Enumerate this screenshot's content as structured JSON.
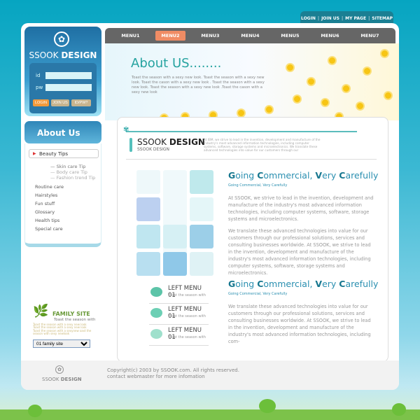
{
  "top_links": [
    "LOGIN",
    "JOIN US",
    "MY PAGE",
    "SITEMAP"
  ],
  "logo": {
    "brand_light": "SSOOK ",
    "brand_bold": "DESIGN"
  },
  "login": {
    "id_label": "id",
    "pw_label": "pw",
    "id_value": "",
    "pw_value": "",
    "buttons": [
      "LOGIN",
      "JOIN US",
      "ID/PW?"
    ]
  },
  "sidebar": {
    "title": "About Us",
    "active": "Beauty Tips",
    "sub_items": [
      "Skin care Tip",
      "Body care Tip",
      "Fashion trend Tip"
    ],
    "items": [
      "Routine care",
      "Hairstyles",
      "Fun stuff",
      "Glossary",
      "Health tips",
      "Special care"
    ]
  },
  "family": {
    "title": "FAMILY SITE",
    "subtitle": "Toast the season with",
    "desc": "Toast the season with a sexy new look Toast the season with a sexy new look Toast the season with a sexynew  oast the season with sexy newlook",
    "select": "01 family site"
  },
  "nav": {
    "items": [
      "MENU1",
      "MENU2",
      "MENU3",
      "MENU4",
      "MENU5",
      "MENU6",
      "MENU7"
    ],
    "active": 1
  },
  "hero": {
    "title": "About US........",
    "desc": "Toast the season with a sexy new look. Toast the season with a sexy new look. Toast the cason with a sexy new look . Toast the season with a sexy new look. Toast the season with a sexy new look .Toast the cason with a sexy new look"
  },
  "card": {
    "brand_light": "SSOOK ",
    "brand_bold": "DESIGN",
    "brand_sub": "SSOOK DESIGN",
    "intro": "At IBM, we strive to lead in the invention, development and manufacture of the industry's most advanced information technologies, including computer systems, software, storage systems and microelectronics. We translate these advanced technologies into value for our customers through our"
  },
  "sections": [
    {
      "title": [
        "G",
        "oing ",
        "C",
        "ommercial, ",
        "V",
        "ery ",
        "C",
        "arefully"
      ],
      "subtitle": "Going Commercial, Very Carefully",
      "paragraphs": [
        "At SSOOK, we strive to lead in the invention, development and manufacture of the industry's most advanced information technologies, including computer systems, software, storage systems and microelectronics.",
        "We translate these advanced technologies into value for our customers through our professional solutions, services and consulting businesses worldwide. At SSOOK, we strive to lead in the invention, development and manufacture of the industry's most advanced information technologies, including computer systems, software, storage systems and microelectronics."
      ]
    },
    {
      "title": [
        "G",
        "oing ",
        "C",
        "ommercial, ",
        "V",
        "ery ",
        "C",
        "arefully"
      ],
      "subtitle": "Going Commercial, Very Carefully",
      "paragraphs": [
        "We translate these advanced technologies into value for our customers through our professional solutions, services and consulting businesses worldwide.  At SSOOK, we strive to lead in the invention, development and manufacture of the industry's most advanced information technologies, including com-"
      ]
    }
  ],
  "left_menus": [
    {
      "title": "LEFT MENU 01",
      "sub": "Toast the season with"
    },
    {
      "title": "LEFT MENU 01",
      "sub": "Toast the season with"
    },
    {
      "title": "LEFT MENU 01",
      "sub": "Toast the season with"
    }
  ],
  "footer": {
    "logo_light": "SSOOK ",
    "logo_bold": "DESIGN",
    "copyright": "Copyright(c) 2003 by SSOOK.com.  All rights reserved.",
    "contact": "contact webmaster for more infomation"
  },
  "colors": {
    "accent": "#26a3a0",
    "nav_active": "#f08c64",
    "nav_bg": "#666666",
    "login_btn": "#f39a3c"
  }
}
